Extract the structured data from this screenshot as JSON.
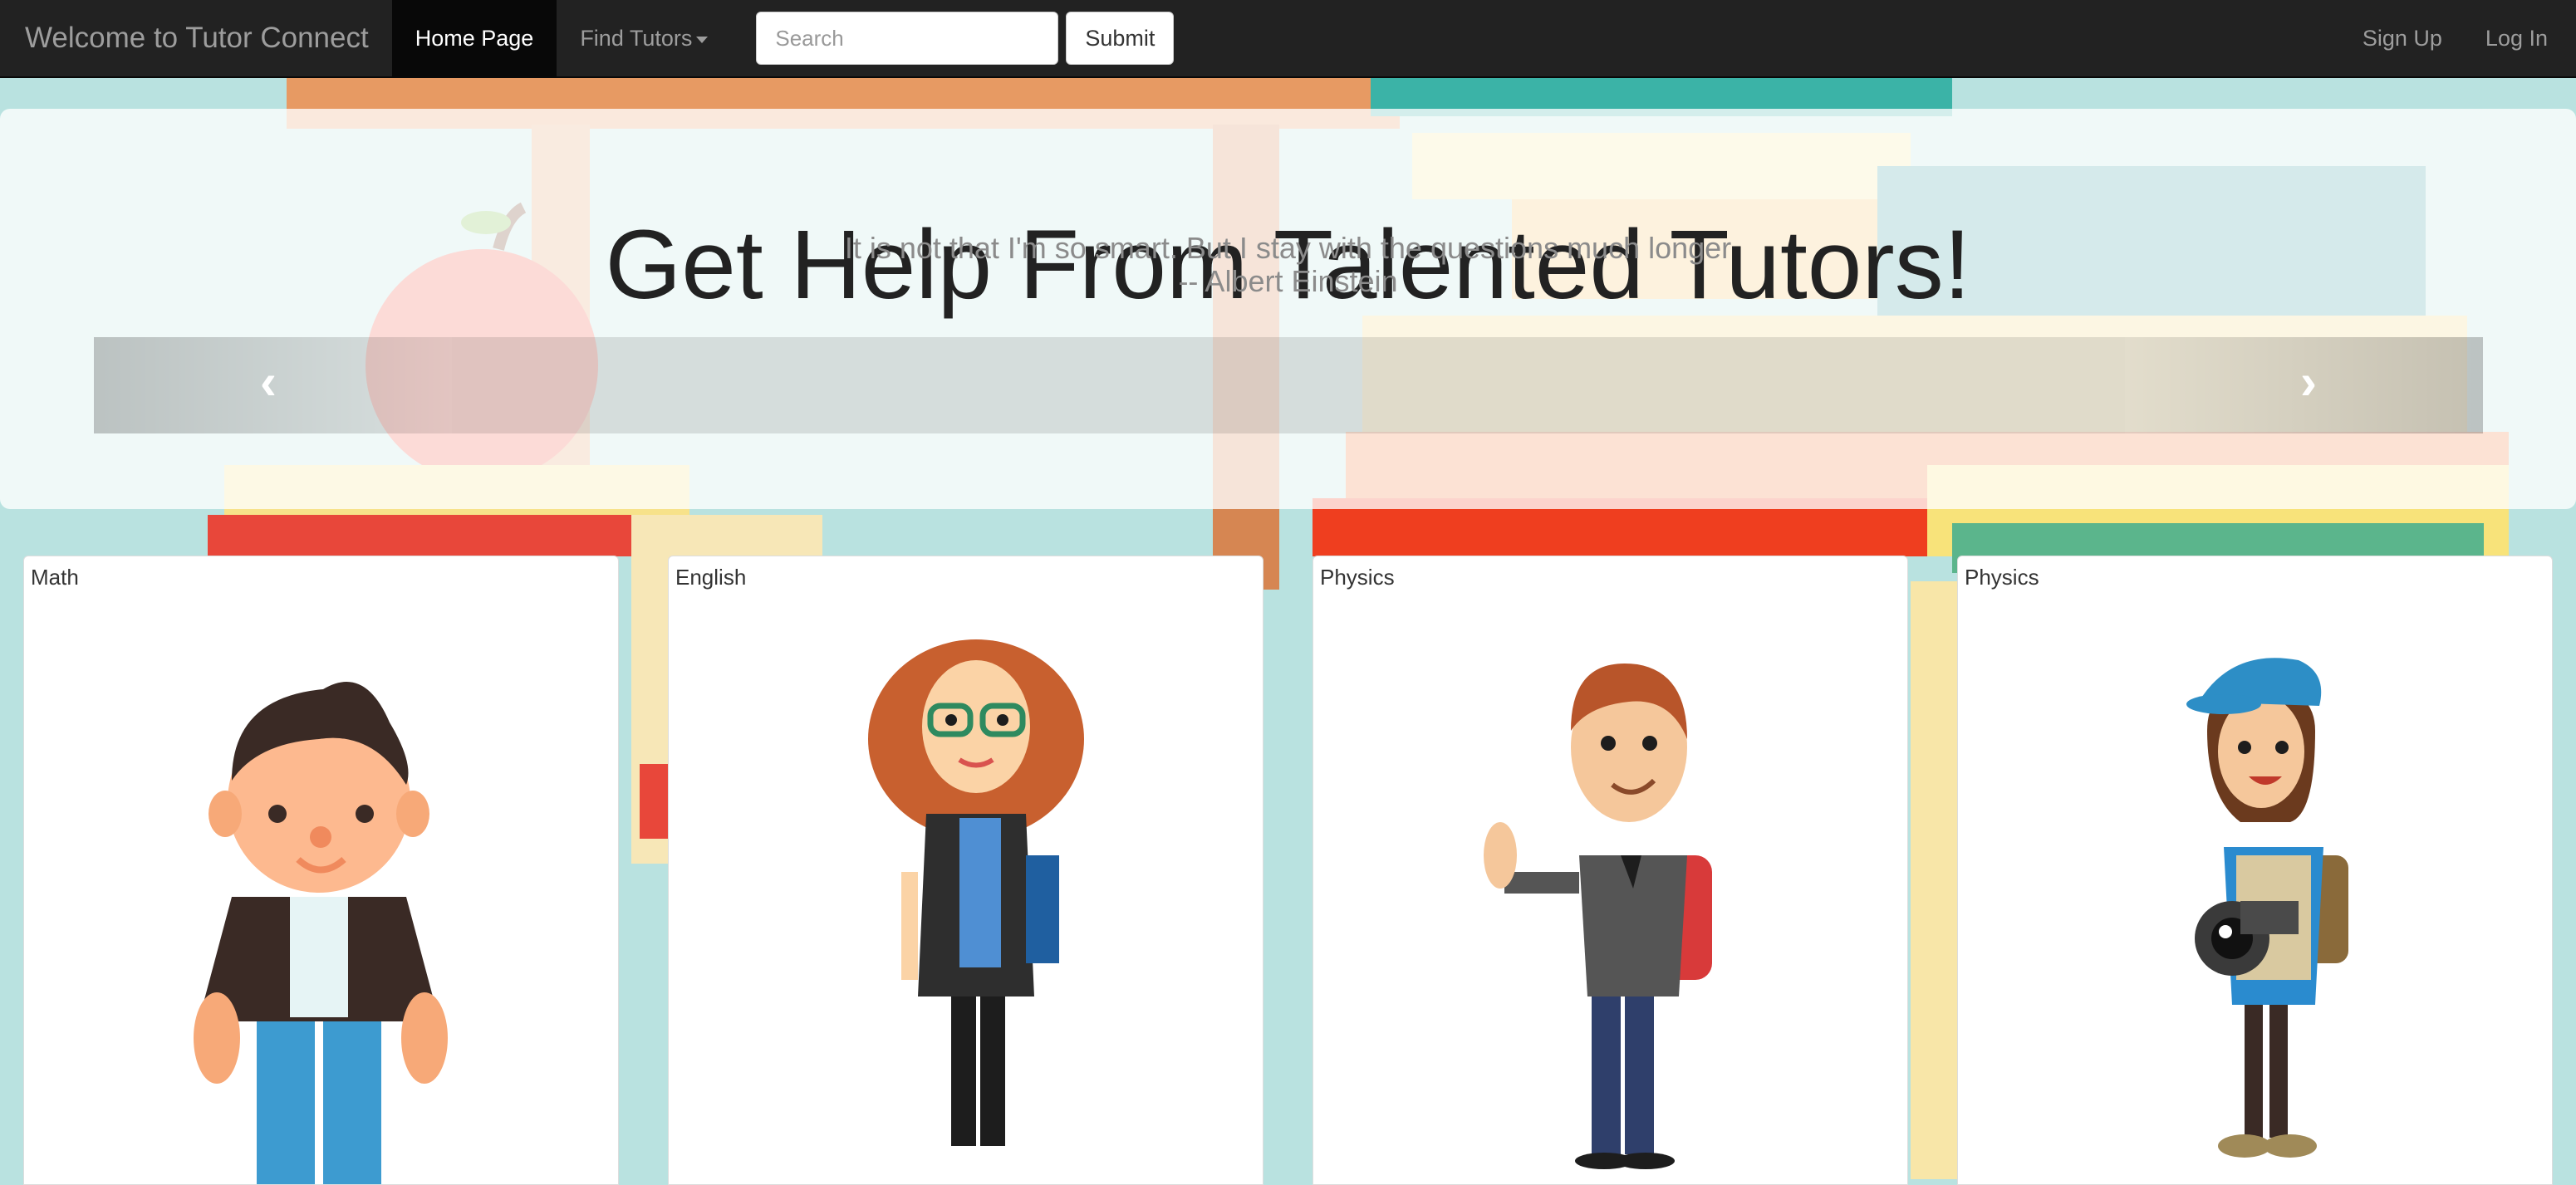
{
  "navbar": {
    "brand": "Welcome to Tutor Connect",
    "home": "Home Page",
    "find_tutors": "Find Tutors",
    "search_placeholder": "Search",
    "submit": "Submit",
    "sign_up": "Sign Up",
    "log_in": "Log In"
  },
  "hero": {
    "headline": "Get Help From Talented Tutors!",
    "quote": "It is not that I'm so smart. But I stay with the questions much longer",
    "author": "-- Albert Einstein"
  },
  "cards": [
    {
      "subject": "Math",
      "icon": "boy-tutor-illustration"
    },
    {
      "subject": "English",
      "icon": "woman-with-glasses-illustration"
    },
    {
      "subject": "Physics",
      "icon": "man-with-backpack-illustration"
    },
    {
      "subject": "Physics",
      "icon": "girl-with-camera-illustration"
    }
  ],
  "colors": {
    "navbar": "#222222",
    "background": "#b9e2e0",
    "headline": "#222222"
  }
}
